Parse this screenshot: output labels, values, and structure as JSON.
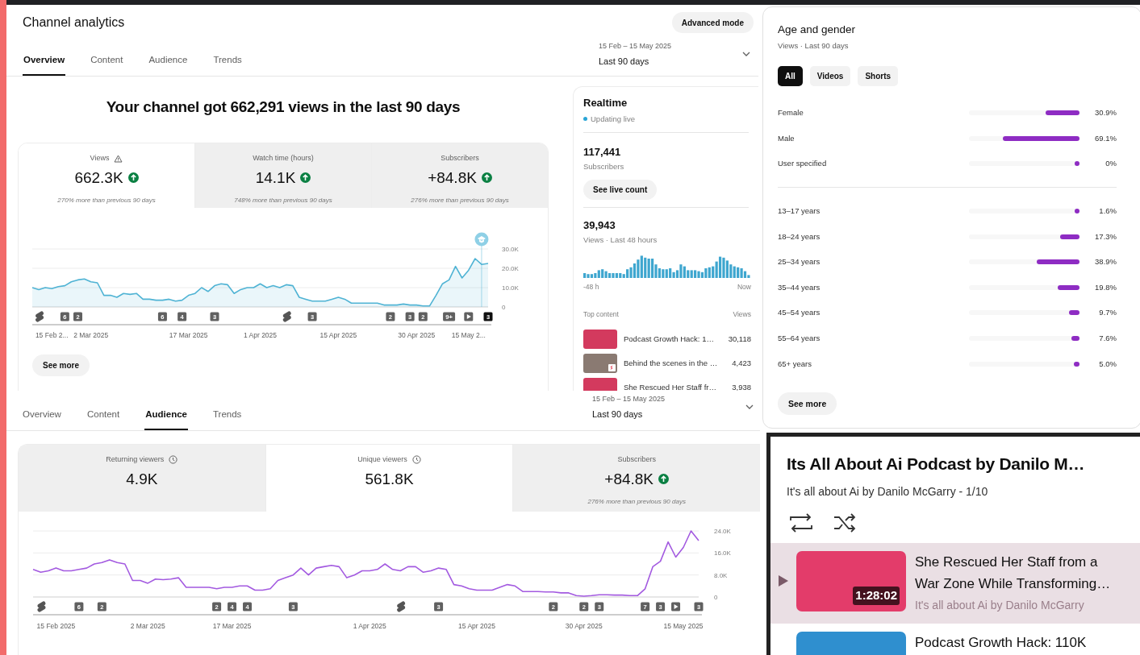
{
  "overview_panel": {
    "title": "Channel analytics",
    "advanced_button": "Advanced mode",
    "tabs": [
      {
        "label": "Overview",
        "selected": true
      },
      {
        "label": "Content",
        "selected": false
      },
      {
        "label": "Audience",
        "selected": false
      },
      {
        "label": "Trends",
        "selected": false
      }
    ],
    "date_range": {
      "dates": "15 Feb – 15 May 2025",
      "period": "Last 90 days"
    },
    "headline": "Your channel got 662,291 views in the last 90 days",
    "metrics": [
      {
        "kind": "flagged",
        "label": "Views",
        "value": "662.3K",
        "caption": "270% more than previous 90 days",
        "selected": true
      },
      {
        "kind": "growth",
        "label": "Watch time (hours)",
        "value": "14.1K",
        "caption": "748% more than previous 90 days",
        "selected": false
      },
      {
        "kind": "growth",
        "label": "Subscribers",
        "value": "+84.8K",
        "caption": "276% more than previous 90 days",
        "selected": false
      }
    ],
    "chart_data": {
      "type": "area",
      "ylim": [
        0,
        30
      ],
      "yticks": [
        {
          "value": 0,
          "label": "0"
        },
        {
          "value": 10,
          "label": "10.0K"
        },
        {
          "value": 20,
          "label": "20.0K"
        },
        {
          "value": 30,
          "label": "30.0K"
        }
      ],
      "categories": [
        null,
        null,
        null,
        "15 Feb 2...",
        null,
        null,
        null,
        null,
        null,
        "2 Mar 2025",
        null,
        null,
        null,
        null,
        null,
        null,
        null,
        null,
        null,
        null,
        null,
        null,
        null,
        null,
        "17 Mar 2025",
        null,
        null,
        null,
        null,
        null,
        null,
        null,
        null,
        null,
        null,
        "1 Apr 2025",
        null,
        null,
        null,
        null,
        null,
        null,
        null,
        null,
        null,
        null,
        null,
        "15 Apr 2025",
        null,
        null,
        null,
        null,
        null,
        null,
        null,
        null,
        null,
        null,
        null,
        "30 Apr 2025",
        null,
        null,
        null,
        null,
        null,
        null,
        null,
        "15 May 2...",
        null,
        null,
        null
      ],
      "series": [
        {
          "color": "#4fb3d4",
          "values": [
            10,
            9,
            10,
            9.5,
            10.5,
            11,
            13,
            14,
            14.5,
            13,
            12.5,
            6,
            6,
            5,
            7,
            6.5,
            7,
            4,
            4,
            3.5,
            3.5,
            4,
            3,
            3.5,
            6,
            7,
            10,
            8,
            11,
            12,
            11.5,
            7,
            9,
            10,
            10,
            12,
            10,
            11,
            10,
            11.5,
            11,
            5,
            4,
            3,
            3,
            3,
            4,
            5,
            4,
            2,
            2,
            2,
            2,
            2,
            1,
            1,
            1,
            1.5,
            1,
            1,
            0.5,
            0.5,
            6,
            12,
            14,
            21,
            15,
            19,
            25,
            22,
            22.5
          ]
        }
      ]
    },
    "event_markers": [
      {
        "kind": "shorts"
      },
      {
        "kind": "count",
        "label": "6"
      },
      {
        "kind": "count",
        "label": "2"
      },
      {
        "kind": "count",
        "label": "6"
      },
      {
        "kind": "count",
        "label": "4"
      },
      {
        "kind": "count",
        "label": "3"
      },
      {
        "kind": "shorts"
      },
      {
        "kind": "count",
        "label": "3"
      },
      {
        "kind": "count",
        "label": "2"
      },
      {
        "kind": "count",
        "label": "3"
      },
      {
        "kind": "count",
        "label": "2"
      },
      {
        "kind": "count",
        "label": "9+"
      },
      {
        "kind": "video"
      },
      {
        "kind": "latest",
        "label": "3"
      }
    ],
    "see_more": "See more"
  },
  "realtime": {
    "title": "Realtime",
    "status": "Updating live",
    "subscribers": {
      "value": "117,441",
      "label": "Subscribers"
    },
    "live_count_button": "See live count",
    "views": {
      "value": "39,943",
      "label": "Views · Last 48 hours"
    },
    "axis_start": "-48 h",
    "axis_end": "Now",
    "top_content_header": "Top content",
    "views_header": "Views",
    "top_content": [
      {
        "title": "Podcast Growth Hack: 1…",
        "views": "30,118",
        "kind": "video"
      },
      {
        "title": "Behind the scenes in the …",
        "views": "4,423",
        "kind": "short"
      },
      {
        "title": "She Rescued Her Staff fr…",
        "views": "3,938",
        "kind": "video"
      }
    ]
  },
  "audience_panel": {
    "tabs": [
      {
        "label": "Overview",
        "selected": false
      },
      {
        "label": "Content",
        "selected": false
      },
      {
        "label": "Audience",
        "selected": true
      },
      {
        "label": "Trends",
        "selected": false
      }
    ],
    "date_range": {
      "dates": "15 Feb – 15 May 2025",
      "period": "Last 90 days"
    },
    "metrics": [
      {
        "kind": "estimated",
        "label": "Returning viewers",
        "value": "4.9K",
        "selected": false
      },
      {
        "kind": "estimated",
        "label": "Unique viewers",
        "value": "561.8K",
        "selected": true
      },
      {
        "kind": "growth",
        "label": "Subscribers",
        "value": "+84.8K",
        "caption": "276% more than previous 90 days",
        "selected": false
      }
    ],
    "chart_data": {
      "type": "line",
      "ylim": [
        0,
        24
      ],
      "yticks": [
        {
          "value": 0,
          "label": "0"
        },
        {
          "value": 8,
          "label": "8.0K"
        },
        {
          "value": 16,
          "label": "16.0K"
        },
        {
          "value": 24,
          "label": "24.0K"
        }
      ],
      "categories": [
        null,
        null,
        null,
        "15 Feb 2025",
        null,
        null,
        null,
        null,
        null,
        null,
        null,
        null,
        null,
        null,
        null,
        "2 Mar 2025",
        null,
        null,
        null,
        null,
        null,
        null,
        null,
        null,
        null,
        null,
        "17 Mar 2025",
        null,
        null,
        null,
        null,
        null,
        null,
        null,
        null,
        null,
        null,
        null,
        null,
        null,
        null,
        null,
        null,
        null,
        "1 Apr 2025",
        null,
        null,
        null,
        null,
        null,
        null,
        null,
        null,
        null,
        null,
        null,
        null,
        null,
        "15 Apr 2025",
        null,
        null,
        null,
        null,
        null,
        null,
        null,
        null,
        null,
        null,
        null,
        null,
        null,
        "30 Apr 2025",
        null,
        null,
        null,
        null,
        null,
        null,
        null,
        null,
        null,
        null,
        null,
        null,
        "15 May 2025",
        null,
        null
      ],
      "series": [
        {
          "color": "#a35ae0",
          "values": [
            10,
            9,
            9.5,
            10.5,
            9.5,
            9.5,
            10,
            10.5,
            12,
            12.5,
            13.5,
            12.5,
            12,
            6,
            6,
            5,
            6.5,
            6.3,
            6.5,
            7,
            3.5,
            3.5,
            3.5,
            3.5,
            3,
            3.5,
            3.5,
            4,
            4,
            2.5,
            2.5,
            3,
            6,
            7,
            8,
            10.5,
            8,
            10.5,
            11,
            11.5,
            11,
            7,
            8,
            9.5,
            9.5,
            10,
            12,
            10,
            9.5,
            11,
            11,
            9,
            9.5,
            10.5,
            10,
            4.5,
            4,
            3,
            2.5,
            2.5,
            2.5,
            3.5,
            4.5,
            4,
            2,
            2,
            2,
            1.8,
            1.8,
            1.5,
            1.5,
            0.5,
            0.3,
            0.5,
            0.8,
            0.8,
            0.7,
            0.7,
            0.5,
            0.5,
            3,
            11,
            13,
            20,
            14.5,
            18,
            24,
            20.5
          ]
        }
      ]
    },
    "event_markers": [
      {
        "kind": "shorts"
      },
      {
        "kind": "count",
        "label": "6"
      },
      {
        "kind": "count",
        "label": "2"
      },
      {
        "kind": "count",
        "label": "2"
      },
      {
        "kind": "count",
        "label": "4"
      },
      {
        "kind": "count",
        "label": "4"
      },
      {
        "kind": "count",
        "label": "3"
      },
      {
        "kind": "shorts"
      },
      {
        "kind": "count",
        "label": "3"
      },
      {
        "kind": "count",
        "label": "2"
      },
      {
        "kind": "count",
        "label": "2"
      },
      {
        "kind": "count",
        "label": "3"
      },
      {
        "kind": "count",
        "label": "7"
      },
      {
        "kind": "count",
        "label": "3"
      },
      {
        "kind": "video"
      },
      {
        "kind": "count",
        "label": "3"
      }
    ]
  },
  "age_gender": {
    "title": "Age and gender",
    "subtitle": "Views · Last 90 days",
    "filters": [
      {
        "label": "All",
        "selected": true
      },
      {
        "label": "Videos",
        "selected": false
      },
      {
        "label": "Shorts",
        "selected": false
      }
    ],
    "gender": [
      {
        "label": "Female",
        "level": 0.309,
        "value": "30.9%"
      },
      {
        "label": "Male",
        "level": 0.691,
        "value": "69.1%"
      },
      {
        "label": "User specified",
        "level": 0,
        "value": "0%"
      }
    ],
    "age": [
      {
        "label": "13–17 years",
        "level": 0.016,
        "value": "1.6%"
      },
      {
        "label": "18–24 years",
        "level": 0.173,
        "value": "17.3%"
      },
      {
        "label": "25–34 years",
        "level": 0.389,
        "value": "38.9%"
      },
      {
        "label": "35–44 years",
        "level": 0.198,
        "value": "19.8%"
      },
      {
        "label": "45–54 years",
        "level": 0.097,
        "value": "9.7%"
      },
      {
        "label": "55–64 years",
        "level": 0.076,
        "value": "7.6%"
      },
      {
        "label": "65+ years",
        "level": 0.05,
        "value": "5.0%"
      }
    ],
    "see_more": "See more"
  },
  "playlist": {
    "title": "Its All About Ai Podcast by Danilo M…",
    "subtitle": "It's all about Ai by Danilo McGarry - 1/10",
    "items": [
      {
        "title": "She Rescued Her Staff from a War Zone While Transforming…",
        "channel": "It's all about Ai by Danilo McGarry",
        "duration": "1:28:02",
        "selected": true
      },
      {
        "title": "Podcast Growth Hack: 110K",
        "selected": false
      }
    ]
  }
}
